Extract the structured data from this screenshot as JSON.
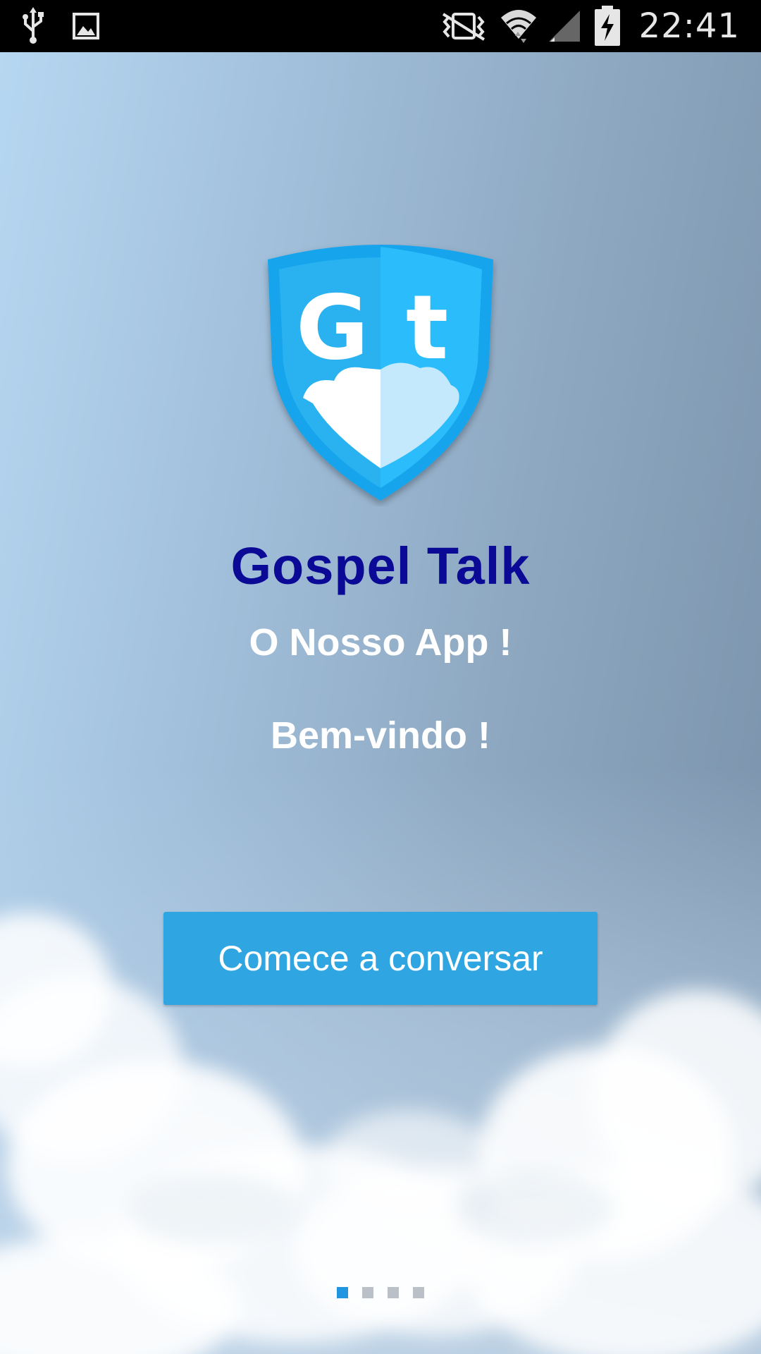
{
  "status_bar": {
    "time": "22:41",
    "left_icons": [
      "usb-icon",
      "image-icon"
    ],
    "right_icons": [
      "vibrate-silent-icon",
      "wifi-icon",
      "signal-icon",
      "battery-charging-icon"
    ]
  },
  "app": {
    "logo_text": "Gt",
    "title": "Gospel Talk",
    "tagline": "O Nosso App !",
    "welcome": "Bem-vindo !",
    "start_button_label": "Comece a conversar"
  },
  "pager": {
    "pages": 4,
    "active_index": 0
  },
  "colors": {
    "title": "#0a0a96",
    "button": "#2fa6e2",
    "shield": "#1aa9ef",
    "active_dot": "#2196e0",
    "inactive_dot": "#b9c0c8"
  }
}
